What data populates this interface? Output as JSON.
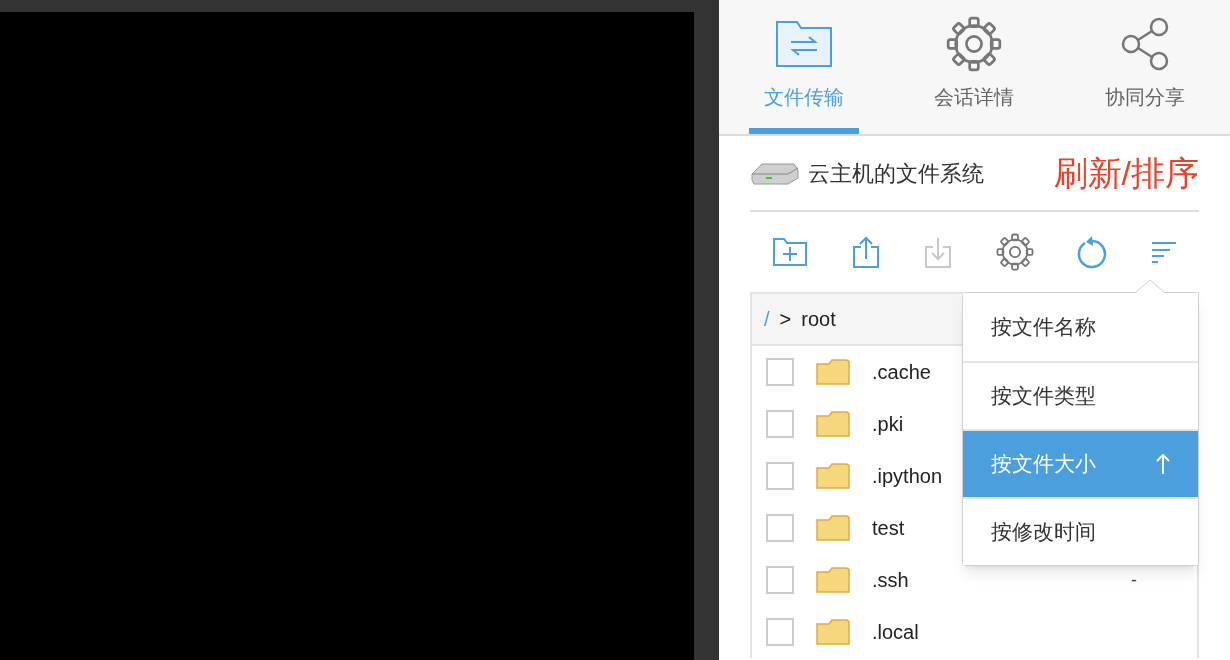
{
  "tabs": [
    {
      "kind": "transfer",
      "label": "文件传输",
      "selected": true
    },
    {
      "kind": "settings",
      "label": "会话详情",
      "selected": false
    },
    {
      "kind": "share",
      "label": "协同分享",
      "selected": false
    }
  ],
  "filesystem": {
    "title": "云主机的文件系统",
    "annotation": "刷新/排序"
  },
  "toolbar": [
    {
      "kind": "new-folder",
      "disabled": false
    },
    {
      "kind": "upload",
      "disabled": false
    },
    {
      "kind": "download",
      "disabled": true
    },
    {
      "kind": "settings",
      "disabled": false
    },
    {
      "kind": "refresh",
      "disabled": false
    },
    {
      "kind": "sort",
      "disabled": false
    }
  ],
  "breadcrumb": [
    "/",
    ">",
    "root"
  ],
  "files": [
    {
      "name": ".cache",
      "checked": false
    },
    {
      "name": ".pki",
      "checked": false
    },
    {
      "name": ".ipython",
      "checked": false
    },
    {
      "name": "test",
      "checked": false
    },
    {
      "name": ".ssh",
      "checked": false,
      "size": "-"
    },
    {
      "name": ".local",
      "checked": false
    }
  ],
  "sort_menu": {
    "ascending": true,
    "items": [
      {
        "label": "按文件名称",
        "selected": false
      },
      {
        "label": "按文件类型",
        "selected": false
      },
      {
        "label": "按文件大小",
        "selected": true
      },
      {
        "label": "按修改时间",
        "selected": false
      }
    ]
  }
}
